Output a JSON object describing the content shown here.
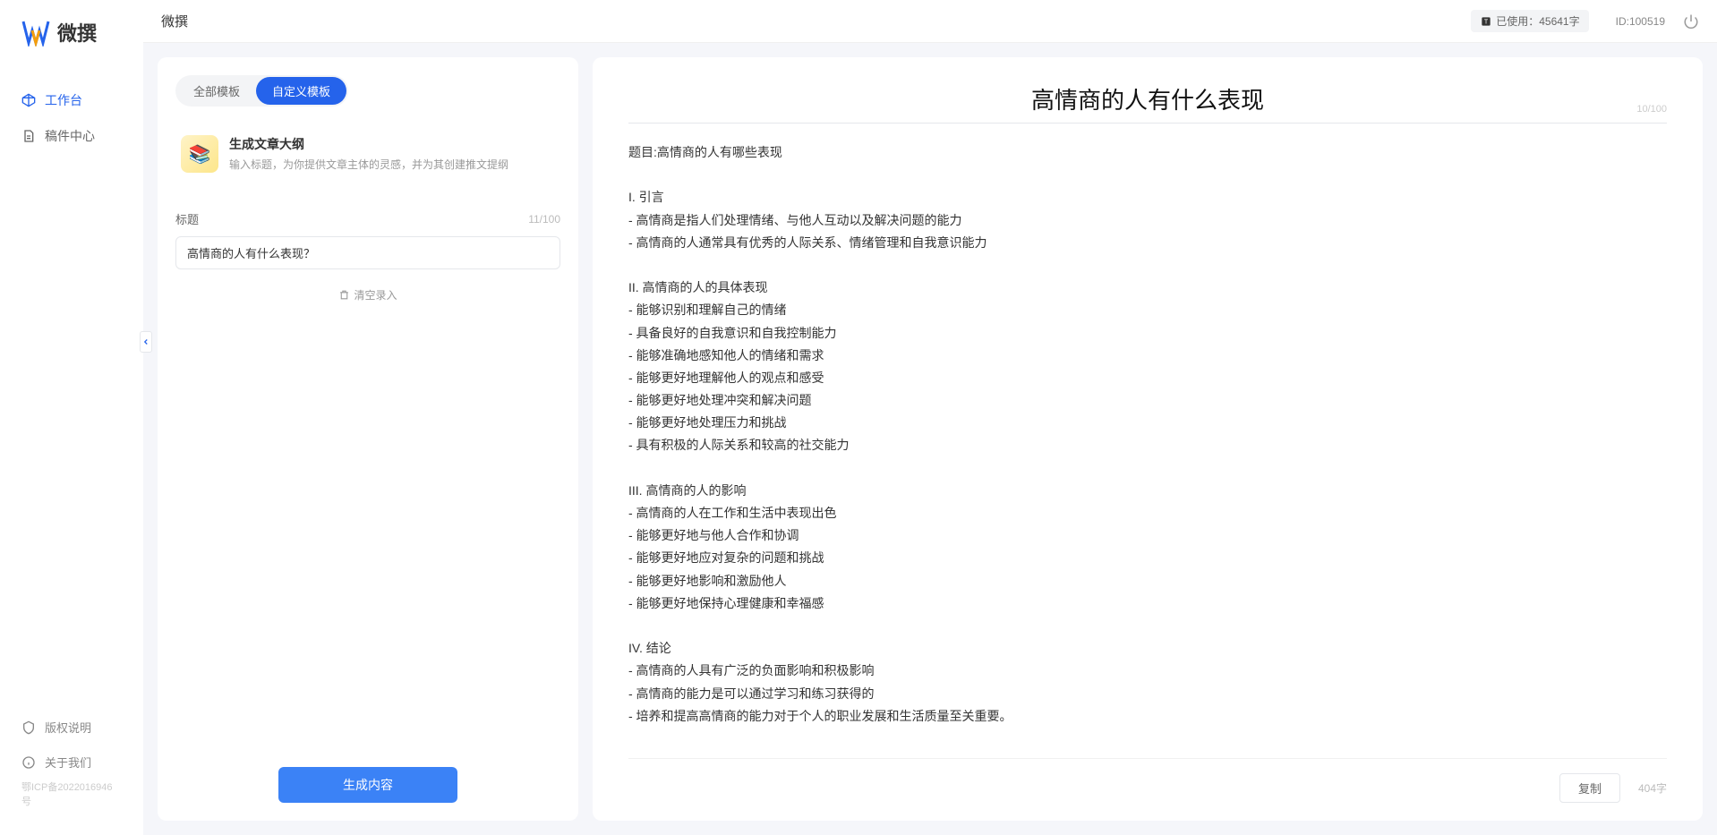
{
  "app": {
    "name": "微撰",
    "icp": "鄂ICP备2022016946号"
  },
  "topbar": {
    "title": "微撰",
    "usage_prefix": "已使用：",
    "usage_value": "45641字",
    "user_id": "ID:100519"
  },
  "sidebar": {
    "items": [
      {
        "label": "工作台",
        "active": true,
        "icon": "cube"
      },
      {
        "label": "稿件中心",
        "active": false,
        "icon": "doc"
      }
    ],
    "bottom": [
      {
        "label": "版权说明",
        "icon": "shield"
      },
      {
        "label": "关于我们",
        "icon": "info"
      }
    ]
  },
  "left_panel": {
    "tabs": [
      {
        "label": "全部模板",
        "active": false
      },
      {
        "label": "自定义模板",
        "active": true
      }
    ],
    "template": {
      "title": "生成文章大纲",
      "desc": "输入标题，为你提供文章主体的灵感，并为其创建推文提纲"
    },
    "field": {
      "label": "标题",
      "counter": "11/100",
      "value": "高情商的人有什么表现？"
    },
    "clear_label": "清空录入",
    "generate_label": "生成内容"
  },
  "output": {
    "title": "高情商的人有什么表现",
    "title_counter": "10/100",
    "body": "题目:高情商的人有哪些表现\n\nI. 引言\n- 高情商是指人们处理情绪、与他人互动以及解决问题的能力\n- 高情商的人通常具有优秀的人际关系、情绪管理和自我意识能力\n\nII. 高情商的人的具体表现\n- 能够识别和理解自己的情绪\n- 具备良好的自我意识和自我控制能力\n- 能够准确地感知他人的情绪和需求\n- 能够更好地理解他人的观点和感受\n- 能够更好地处理冲突和解决问题\n- 能够更好地处理压力和挑战\n- 具有积极的人际关系和较高的社交能力\n\nIII. 高情商的人的影响\n- 高情商的人在工作和生活中表现出色\n- 能够更好地与他人合作和协调\n- 能够更好地应对复杂的问题和挑战\n- 能够更好地影响和激励他人\n- 能够更好地保持心理健康和幸福感\n\nIV. 结论\n- 高情商的人具有广泛的负面影响和积极影响\n- 高情商的能力是可以通过学习和练习获得的\n- 培养和提高高情商的能力对于个人的职业发展和生活质量至关重要。",
    "copy_label": "复制",
    "char_count": "404字"
  }
}
